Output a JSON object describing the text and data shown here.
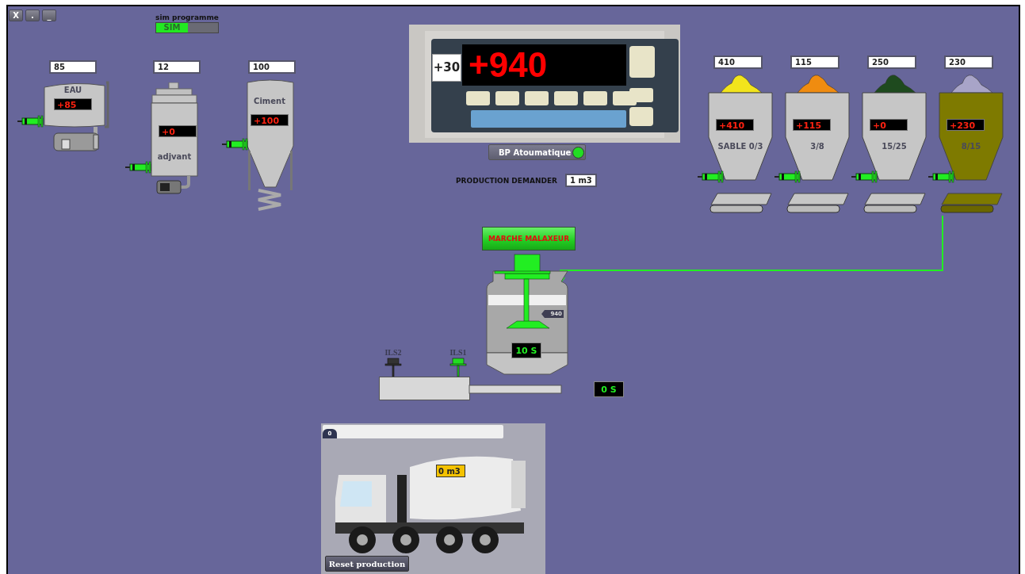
{
  "window_buttons": [
    "X",
    ".",
    "_"
  ],
  "sim": {
    "label": "sim programme",
    "button": "SIM",
    "on": true
  },
  "tanks": [
    {
      "kind": "water",
      "setpoint": "85",
      "name": "EAU",
      "reading": "+85"
    },
    {
      "kind": "admix",
      "setpoint": "12",
      "name": "adjvant",
      "reading": "+0"
    },
    {
      "kind": "silo",
      "setpoint": "100",
      "name": "Ciment",
      "reading": "+100"
    }
  ],
  "scale": {
    "tare": "+30",
    "weight": "+940"
  },
  "auto_button": {
    "label": "BP Atoumatique",
    "on": true
  },
  "production": {
    "label": "PRODUCTION DEMANDER",
    "value": "1 m3"
  },
  "hoppers": [
    {
      "setpoint": "410",
      "reading": "+410",
      "name": "SABLE 0/3",
      "color": "#f2e41c",
      "active": false
    },
    {
      "setpoint": "115",
      "reading": "+115",
      "name": "3/8",
      "color": "#f08c10",
      "active": false
    },
    {
      "setpoint": "250",
      "reading": "+0",
      "name": "15/25",
      "color": "#1e4a1e",
      "active": false
    },
    {
      "setpoint": "230",
      "reading": "+230",
      "name": "8/15",
      "color": "#a8a4c8",
      "active": true
    }
  ],
  "mixer": {
    "button": "MARCHE MALAXEUR",
    "running": true,
    "level_tag": "940",
    "timer": "10 S"
  },
  "sensors": [
    {
      "name": "ILS2",
      "active": false
    },
    {
      "name": "ILS1",
      "active": true
    }
  ],
  "discharge_timer": "0 S",
  "truck": {
    "tag": "0",
    "load": "0 m3",
    "reset": "Reset production"
  }
}
